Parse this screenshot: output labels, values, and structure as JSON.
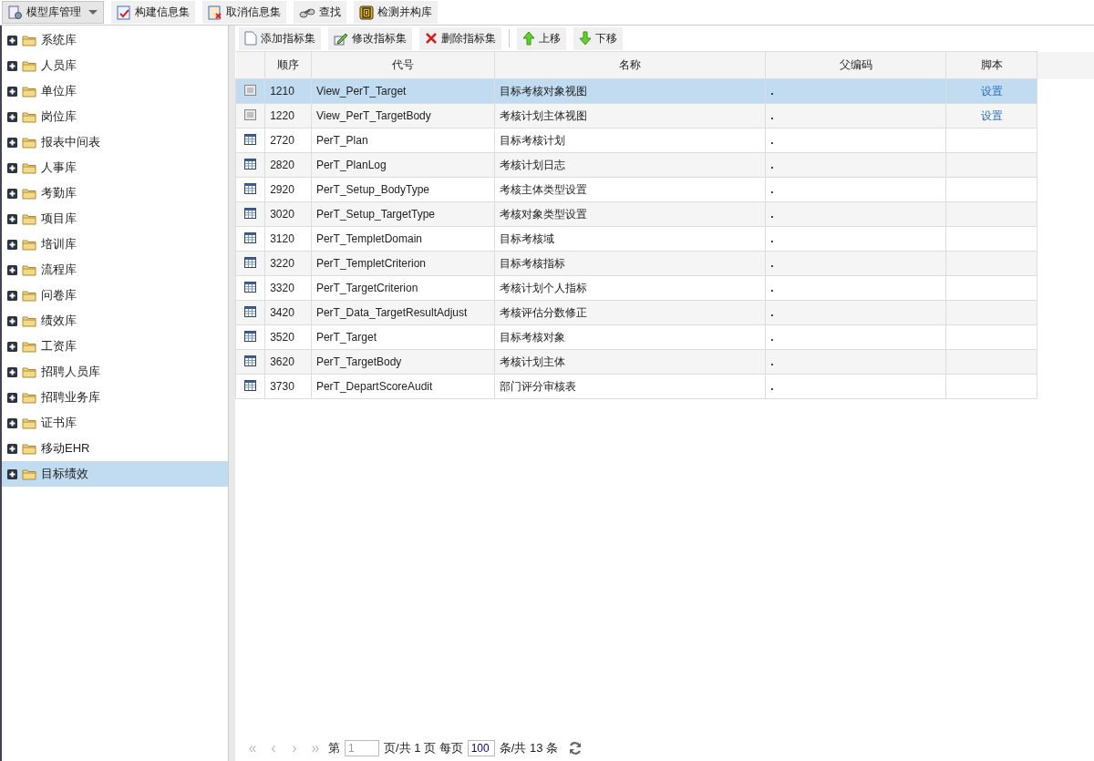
{
  "top_toolbar": [
    {
      "kind": "menu",
      "label": "模型库管理"
    },
    {
      "kind": "build",
      "label": "构建信息集"
    },
    {
      "kind": "cancel",
      "label": "取消信息集"
    },
    {
      "kind": "find",
      "label": "查找"
    },
    {
      "kind": "check",
      "label": "检测并构库"
    }
  ],
  "tree": [
    {
      "label": "系统库",
      "selected": false
    },
    {
      "label": "人员库",
      "selected": false
    },
    {
      "label": "单位库",
      "selected": false
    },
    {
      "label": "岗位库",
      "selected": false
    },
    {
      "label": "报表中间表",
      "selected": false
    },
    {
      "label": "人事库",
      "selected": false
    },
    {
      "label": "考勤库",
      "selected": false
    },
    {
      "label": "项目库",
      "selected": false
    },
    {
      "label": "培训库",
      "selected": false
    },
    {
      "label": "流程库",
      "selected": false
    },
    {
      "label": "问卷库",
      "selected": false
    },
    {
      "label": "绩效库",
      "selected": false
    },
    {
      "label": "工资库",
      "selected": false
    },
    {
      "label": "招聘人员库",
      "selected": false
    },
    {
      "label": "招聘业务库",
      "selected": false
    },
    {
      "label": "证书库",
      "selected": false
    },
    {
      "label": "移动EHR",
      "selected": false
    },
    {
      "label": "目标绩效",
      "selected": true
    }
  ],
  "grid_toolbar": [
    {
      "kind": "add",
      "label": "添加指标集"
    },
    {
      "kind": "edit",
      "label": "修改指标集"
    },
    {
      "kind": "delete",
      "label": "删除指标集"
    },
    {
      "kind": "up",
      "label": "上移"
    },
    {
      "kind": "down",
      "label": "下移"
    }
  ],
  "table": {
    "columns": [
      "顺序",
      "代号",
      "名称",
      "父编码",
      "脚本"
    ],
    "rows": [
      {
        "kind": "view",
        "selected": true,
        "order": "1210",
        "code": "View_PerT_Target",
        "name": "目标考核对象视图",
        "parent": ".",
        "script": "设置"
      },
      {
        "kind": "view",
        "selected": false,
        "order": "1220",
        "code": "View_PerT_TargetBody",
        "name": "考核计划主体视图",
        "parent": ".",
        "script": "设置"
      },
      {
        "kind": "table",
        "selected": false,
        "order": "2720",
        "code": "PerT_Plan",
        "name": "目标考核计划",
        "parent": "."
      },
      {
        "kind": "table",
        "selected": false,
        "order": "2820",
        "code": "PerT_PlanLog",
        "name": "考核计划日志",
        "parent": "."
      },
      {
        "kind": "table",
        "selected": false,
        "order": "2920",
        "code": "PerT_Setup_BodyType",
        "name": "考核主体类型设置",
        "parent": "."
      },
      {
        "kind": "table",
        "selected": false,
        "order": "3020",
        "code": "PerT_Setup_TargetType",
        "name": "考核对象类型设置",
        "parent": "."
      },
      {
        "kind": "table",
        "selected": false,
        "order": "3120",
        "code": "PerT_TempletDomain",
        "name": "目标考核域",
        "parent": "."
      },
      {
        "kind": "table",
        "selected": false,
        "order": "3220",
        "code": "PerT_TempletCriterion",
        "name": "目标考核指标",
        "parent": "."
      },
      {
        "kind": "table",
        "selected": false,
        "order": "3320",
        "code": "PerT_TargetCriterion",
        "name": "考核计划个人指标",
        "parent": "."
      },
      {
        "kind": "table",
        "selected": false,
        "order": "3420",
        "code": "PerT_Data_TargetResultAdjust",
        "name": "考核评估分数修正",
        "parent": "."
      },
      {
        "kind": "table",
        "selected": false,
        "order": "3520",
        "code": "PerT_Target",
        "name": "目标考核对象",
        "parent": "."
      },
      {
        "kind": "table",
        "selected": false,
        "order": "3620",
        "code": "PerT_TargetBody",
        "name": "考核计划主体",
        "parent": "."
      },
      {
        "kind": "table",
        "selected": false,
        "order": "3730",
        "code": "PerT_DepartScoreAudit",
        "name": "部门评分审核表",
        "parent": "."
      }
    ]
  },
  "pager": {
    "nav": [
      {
        "label": "«",
        "disabled": true
      },
      {
        "label": "‹",
        "disabled": true
      },
      {
        "label": "›",
        "disabled": true
      },
      {
        "label": "»",
        "disabled": true
      }
    ],
    "page_prefix": "第",
    "page": "1",
    "page_suffix": "页/共 1 页 每页",
    "page_size": "100",
    "total": "条/共 13 条"
  }
}
